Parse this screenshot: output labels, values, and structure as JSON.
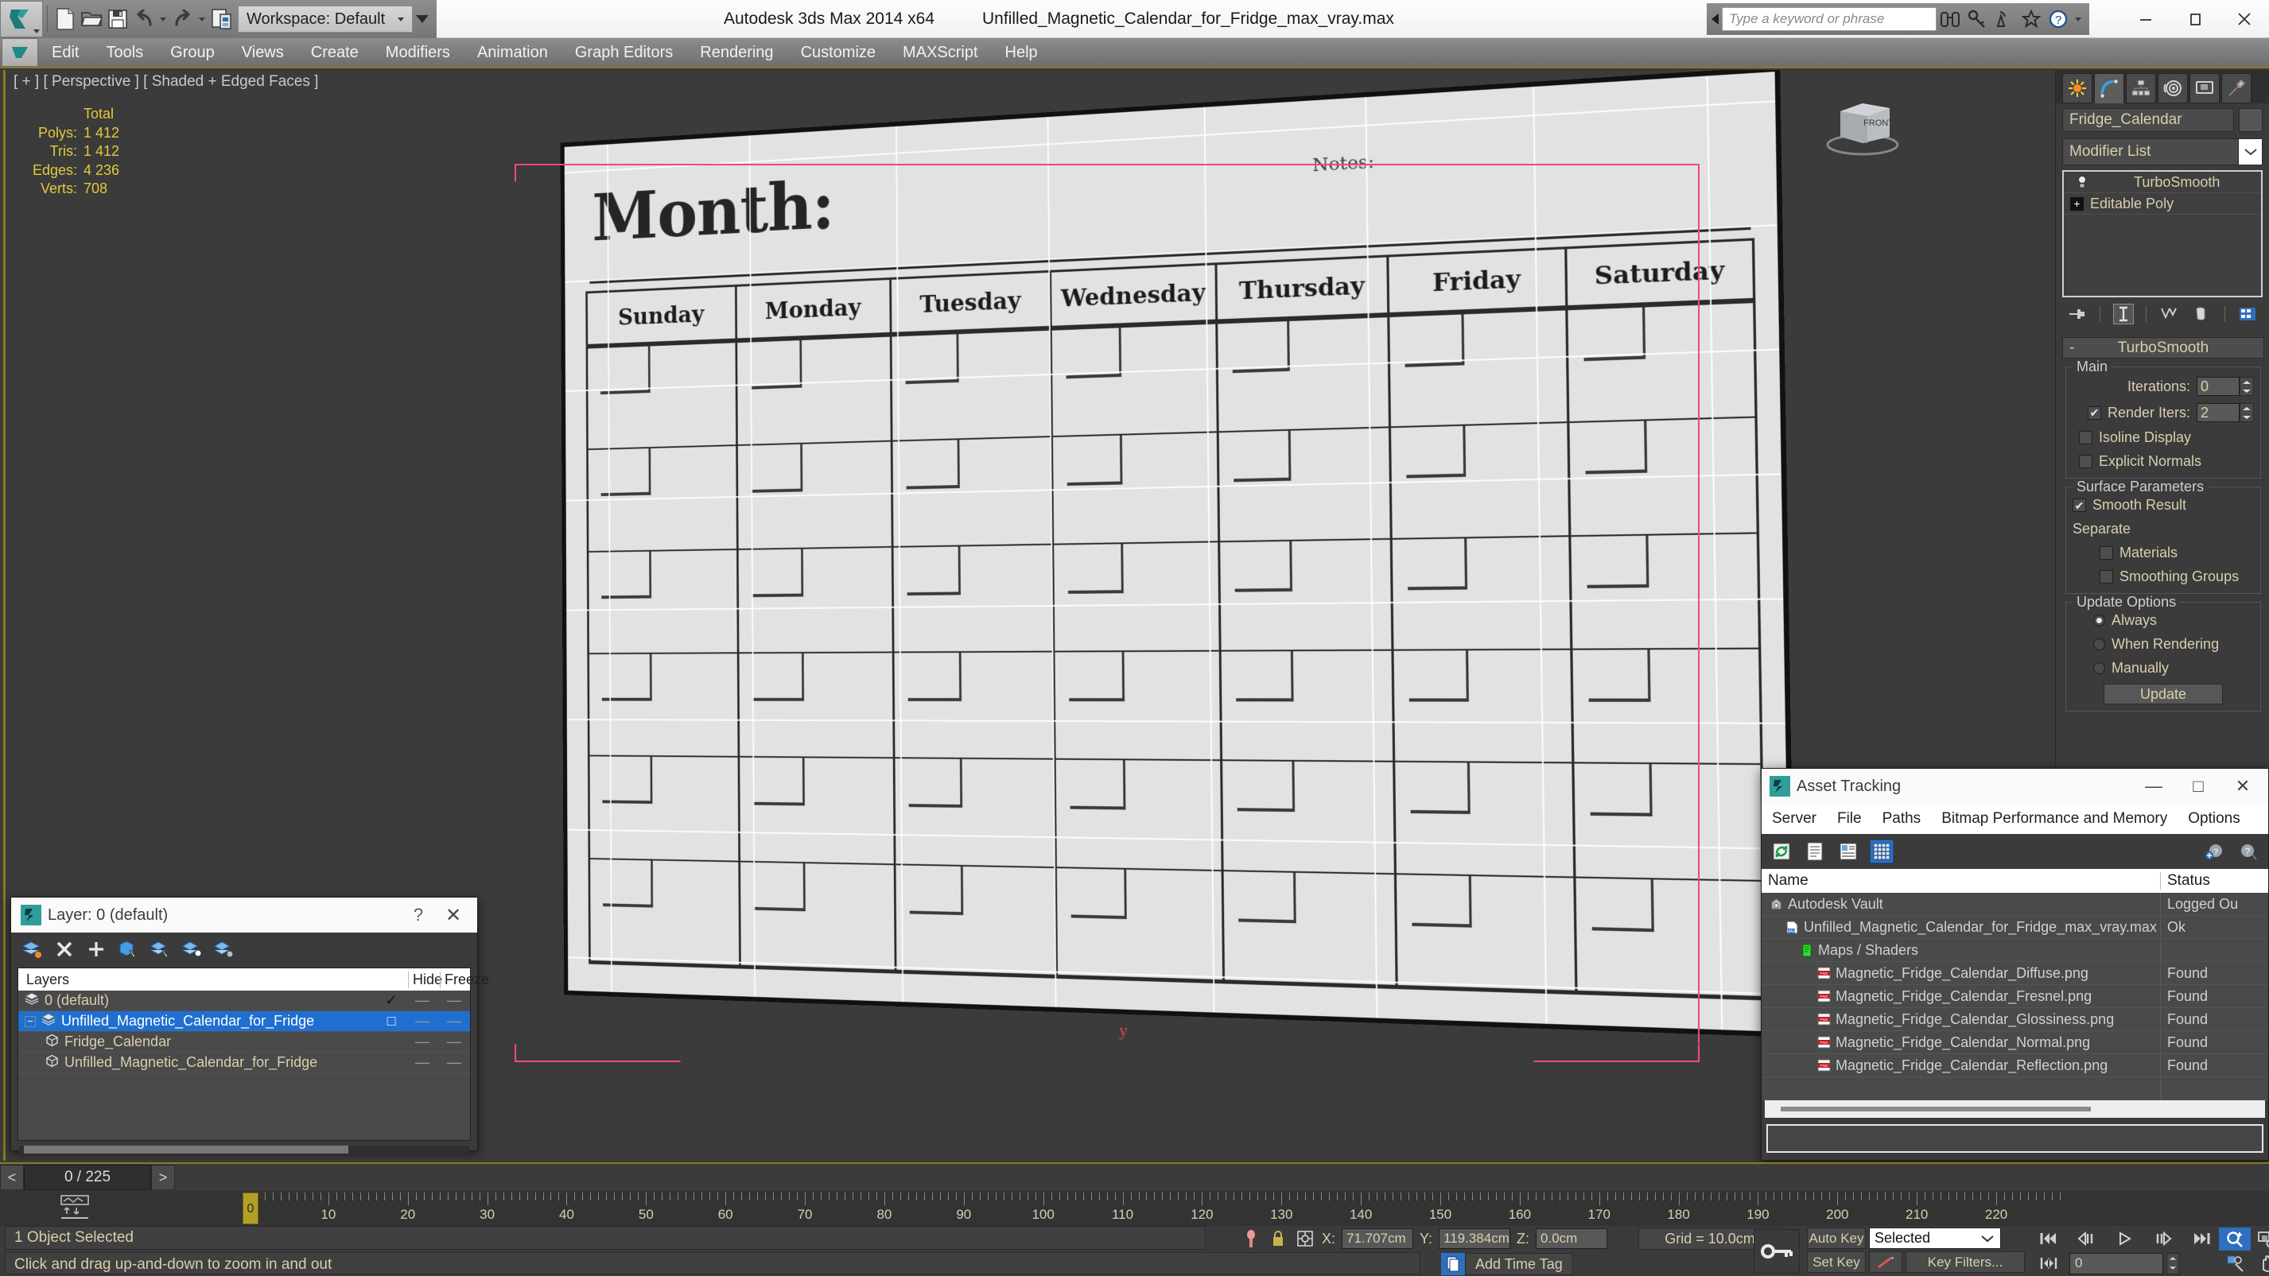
{
  "titlebar": {
    "app_title": "Autodesk 3ds Max  2014 x64",
    "file_name": "Unfilled_Magnetic_Calendar_for_Fridge_max_vray.max",
    "workspace": "Workspace: Default",
    "search_placeholder": "Type a keyword or phrase",
    "quick_access": [
      "new-icon",
      "open-icon",
      "save-icon",
      "undo-icon",
      "redo-icon",
      "set-project-icon"
    ],
    "help_icons": [
      "binoculars-icon",
      "key-icon",
      "satellite-icon",
      "star-icon",
      "help-icon"
    ],
    "window_buttons": [
      "minimize",
      "maximize",
      "close"
    ]
  },
  "menu": {
    "items": [
      "Edit",
      "Tools",
      "Group",
      "Views",
      "Create",
      "Modifiers",
      "Animation",
      "Graph Editors",
      "Rendering",
      "Customize",
      "MAXScript",
      "Help"
    ]
  },
  "viewport": {
    "label": "[ + ] [ Perspective ] [ Shaded + Edged Faces ]",
    "stats": {
      "header": "Total",
      "rows": [
        {
          "label": "Polys:",
          "value": "1 412"
        },
        {
          "label": "Tris:",
          "value": "1 412"
        },
        {
          "label": "Edges:",
          "value": "4 236"
        },
        {
          "label": "Verts:",
          "value": "708"
        }
      ]
    },
    "axis_label": "y",
    "viewcube_face": "FRONT",
    "model": {
      "title": "Month:",
      "notes": "Notes:",
      "days": [
        "Sunday",
        "Monday",
        "Tuesday",
        "Wednesday",
        "Thursday",
        "Friday",
        "Saturday"
      ],
      "week_rows": 6
    }
  },
  "command_panel": {
    "tabs": [
      "create-tab",
      "modify-tab",
      "hierarchy-tab",
      "motion-tab",
      "display-tab",
      "utilities-tab"
    ],
    "active_tab_index": 1,
    "object_name": "Fridge_Calendar",
    "modifier_list_label": "Modifier List",
    "stack": [
      {
        "label": "TurboSmooth",
        "icon": "lightbulb-icon",
        "selected": true
      },
      {
        "label": "Editable Poly",
        "icon": "plus-box-icon",
        "selected": false
      }
    ],
    "stack_buttons": [
      "pin-stack-icon",
      "show-end-result-icon",
      "make-unique-icon",
      "remove-modifier-icon",
      "configure-sets-icon"
    ],
    "rollout": {
      "title": "TurboSmooth",
      "collapse_symbol": "-",
      "groups": [
        {
          "title": "Main",
          "fields": [
            {
              "type": "spinner",
              "label": "Iterations:",
              "value": "0"
            },
            {
              "type": "checkbox_spinner",
              "label": "Render Iters:",
              "value": "2",
              "checked": true
            },
            {
              "type": "checkbox",
              "label": "Isoline Display",
              "checked": false
            },
            {
              "type": "checkbox",
              "label": "Explicit Normals",
              "checked": false
            }
          ]
        },
        {
          "title": "Surface Parameters",
          "fields": [
            {
              "type": "checkbox",
              "label": "Smooth Result",
              "checked": true
            },
            {
              "type": "text",
              "label": "Separate"
            },
            {
              "type": "checkbox",
              "label": "Materials",
              "checked": false
            },
            {
              "type": "checkbox",
              "label": "Smoothing Groups",
              "checked": false
            }
          ]
        },
        {
          "title": "Update Options",
          "fields": [
            {
              "type": "radio",
              "label": "Always",
              "checked": true
            },
            {
              "type": "radio",
              "label": "When Rendering",
              "checked": false
            },
            {
              "type": "radio",
              "label": "Manually",
              "checked": false
            }
          ],
          "button": "Update"
        }
      ]
    }
  },
  "layer_dialog": {
    "title": "Layer: 0 (default)",
    "help_glyph": "?",
    "close_glyph": "✕",
    "toolbar_icons": [
      "new-layer-icon",
      "delete-layer-icon",
      "add-layer-icon",
      "select-objects-icon",
      "select-highlighted-icon",
      "add-selection-icon",
      "set-current-icon"
    ],
    "columns": [
      "Layers",
      "",
      "Hide",
      "Freeze"
    ],
    "rows": [
      {
        "name": "0 (default)",
        "icon": "layer-icon",
        "current": "✓",
        "hide": "—",
        "freeze": "—",
        "selected": false,
        "indent": 0
      },
      {
        "name": "Unfilled_Magnetic_Calendar_for_Fridge",
        "icon": "layer-icon",
        "current": "□",
        "hide": "—",
        "freeze": "—",
        "selected": true,
        "indent": 0,
        "expander": "−"
      },
      {
        "name": "Fridge_Calendar",
        "icon": "object-icon",
        "current": "",
        "hide": "—",
        "freeze": "—",
        "selected": false,
        "indent": 1
      },
      {
        "name": "Unfilled_Magnetic_Calendar_for_Fridge",
        "icon": "object-icon",
        "current": "",
        "hide": "—",
        "freeze": "—",
        "selected": false,
        "indent": 1
      }
    ]
  },
  "asset_tracking": {
    "title": "Asset Tracking",
    "window_buttons": [
      "—",
      "□",
      "✕"
    ],
    "menu": [
      "Server",
      "File",
      "Paths",
      "Bitmap Performance and Memory",
      "Options"
    ],
    "toolbar_icons": [
      "refresh-icon",
      "list-view-icon",
      "detail-view-icon",
      "grid-view-icon"
    ],
    "toolbar_right_icons": [
      "add-help-icon",
      "help-icon"
    ],
    "columns": [
      "Name",
      "Status"
    ],
    "rows": [
      {
        "name": "Autodesk Vault",
        "status": "Logged Ou",
        "icon": "vault-icon",
        "indent": 0
      },
      {
        "name": "Unfilled_Magnetic_Calendar_for_Fridge_max_vray.max",
        "status": "Ok",
        "icon": "max-file-icon",
        "indent": 1
      },
      {
        "name": "Maps / Shaders",
        "status": "",
        "icon": "maps-icon",
        "indent": 2
      },
      {
        "name": "Magnetic_Fridge_Calendar_Diffuse.png",
        "status": "Found",
        "icon": "png-icon",
        "indent": 3
      },
      {
        "name": "Magnetic_Fridge_Calendar_Fresnel.png",
        "status": "Found",
        "icon": "png-icon",
        "indent": 3
      },
      {
        "name": "Magnetic_Fridge_Calendar_Glossiness.png",
        "status": "Found",
        "icon": "png-icon",
        "indent": 3
      },
      {
        "name": "Magnetic_Fridge_Calendar_Normal.png",
        "status": "Found",
        "icon": "png-icon",
        "indent": 3
      },
      {
        "name": "Magnetic_Fridge_Calendar_Reflection.png",
        "status": "Found",
        "icon": "png-icon",
        "indent": 3
      },
      {
        "name": "",
        "status": "",
        "icon": "",
        "indent": 0
      }
    ]
  },
  "timeline": {
    "frame_indicator": "0 / 225",
    "prev_glyph": "<",
    "next_glyph": ">",
    "slider_label": "0",
    "ticks": [
      0,
      10,
      20,
      30,
      40,
      50,
      60,
      70,
      80,
      90,
      100,
      110,
      120,
      130,
      140,
      150,
      160,
      170,
      180,
      190,
      200,
      210,
      220
    ]
  },
  "statusbar": {
    "selection_text": "1 Object Selected",
    "prompt": "Click and drag up-and-down to zoom in and out",
    "coords": [
      {
        "label": "X:",
        "value": "71.707cm"
      },
      {
        "label": "Y:",
        "value": "119.384cm"
      },
      {
        "label": "Z:",
        "value": "0.0cm"
      }
    ],
    "grid": "Grid = 10.0cm",
    "add_time_tag": "Add Time Tag",
    "auto_key": "Auto Key",
    "set_key": "Set Key",
    "key_filters": "Key Filters...",
    "selection_set": "Selected",
    "frame_field": "0",
    "playback_icons": [
      "go-to-start-icon",
      "prev-frame-icon",
      "play-icon",
      "next-frame-icon",
      "go-to-end-icon"
    ],
    "nav_icons": [
      "zoom-icon",
      "zoom-all-icon",
      "zoom-extents-icon",
      "zoom-extents-all-icon",
      "field-of-view-icon",
      "walkthrough-icon",
      "pan-icon",
      "arc-rotate-icon",
      "maximize-viewport-icon"
    ]
  },
  "colors": {
    "accent_yellow": "#8a7a22",
    "panel_bg": "#3b3b3b",
    "text_tan": "#d8cfae",
    "selection_blue": "#1f6fd0",
    "stats_yellow": "#e3c93c",
    "selection_pink": "#ef4a7b"
  }
}
